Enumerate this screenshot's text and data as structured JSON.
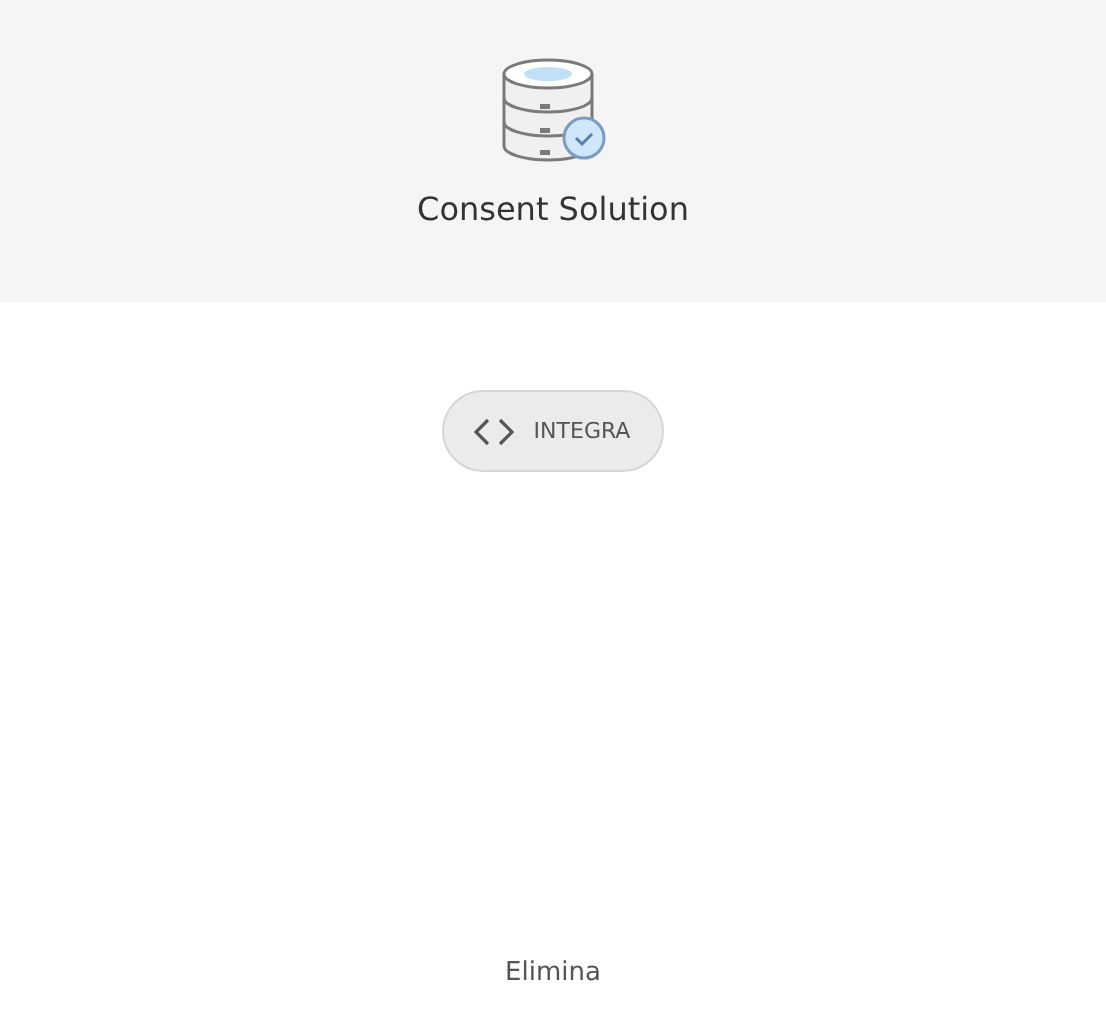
{
  "header": {
    "title": "Consent Solution"
  },
  "actions": [
    {
      "kind": "integrate",
      "label": "INTEGRA"
    }
  ],
  "footer_link": "Elimina"
}
